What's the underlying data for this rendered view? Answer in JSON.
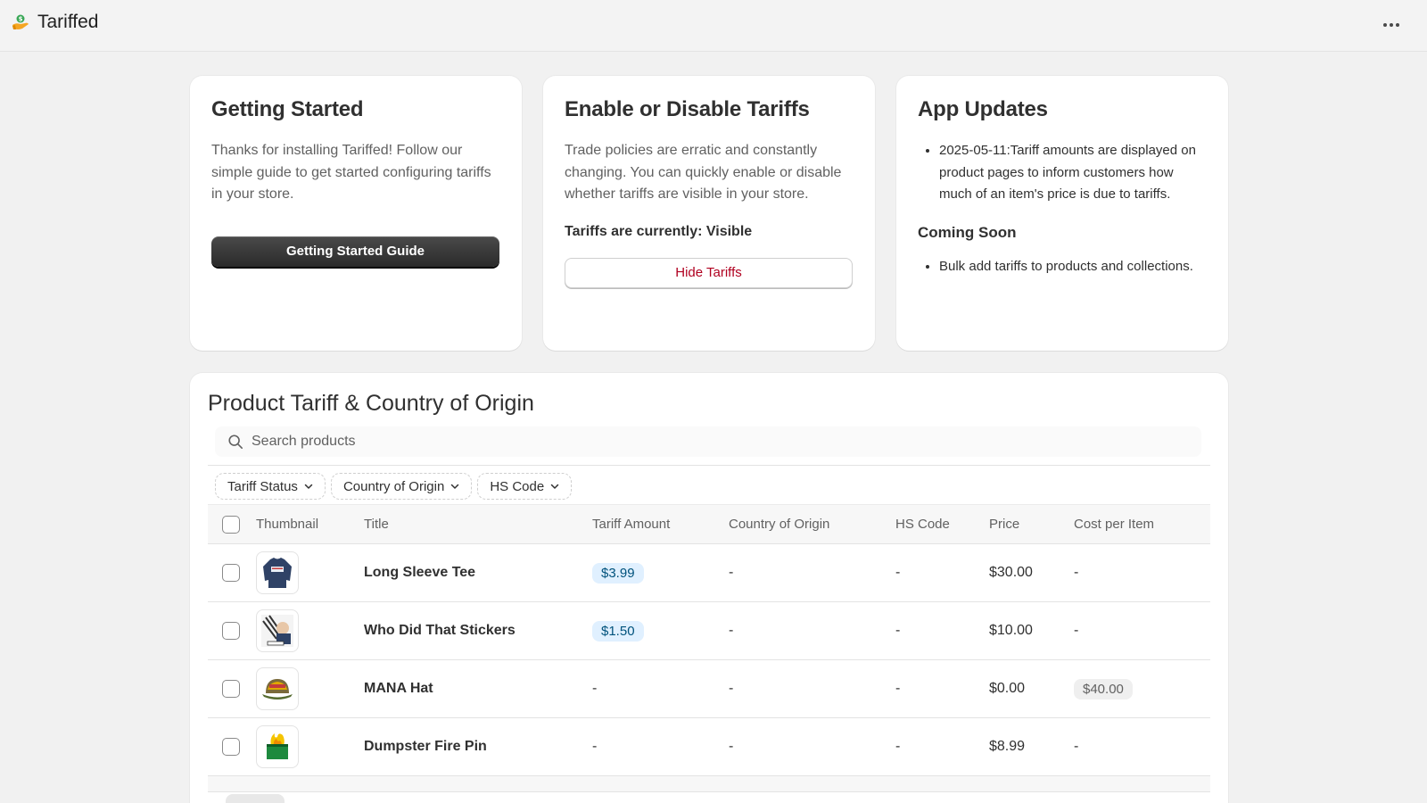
{
  "app": {
    "name": "Tariffed"
  },
  "getting_started": {
    "title": "Getting Started",
    "body": "Thanks for installing Tariffed! Follow our simple guide to get started configuring tariffs in your store.",
    "button_label": "Getting Started Guide"
  },
  "enable_disable": {
    "title": "Enable or Disable Tariffs",
    "body": "Trade policies are erratic and constantly changing. You can quickly enable or disable whether tariffs are visible in your store.",
    "status_label": "Tariffs are currently: Visible",
    "button_label": "Hide Tariffs"
  },
  "app_updates": {
    "title": "App Updates",
    "updates": [
      "2025-05-11:Tariff amounts are displayed on product pages to inform customers how much of an item's price is due to tariffs."
    ],
    "coming_soon_title": "Coming Soon",
    "coming_soon": [
      "Bulk add tariffs to products and collections."
    ]
  },
  "products": {
    "title": "Product Tariff & Country of Origin",
    "search_placeholder": "Search products",
    "filters": [
      "Tariff Status",
      "Country of Origin",
      "HS Code"
    ],
    "columns": {
      "thumbnail": "Thumbnail",
      "title": "Title",
      "tariff": "Tariff Amount",
      "country": "Country of Origin",
      "hs": "HS Code",
      "price": "Price",
      "cost": "Cost per Item"
    },
    "rows": [
      {
        "title": "Long Sleeve Tee",
        "tariff": "$3.99",
        "country": "-",
        "hs": "-",
        "price": "$30.00",
        "cost": "-"
      },
      {
        "title": "Who Did That Stickers",
        "tariff": "$1.50",
        "country": "-",
        "hs": "-",
        "price": "$10.00",
        "cost": "-"
      },
      {
        "title": "MANA Hat",
        "tariff": "-",
        "country": "-",
        "hs": "-",
        "price": "$0.00",
        "cost": "$40.00"
      },
      {
        "title": "Dumpster Fire Pin",
        "tariff": "-",
        "country": "-",
        "hs": "-",
        "price": "$8.99",
        "cost": "-"
      }
    ]
  },
  "icons": {
    "brand": "tariffed-logo-icon",
    "more": "more-horizontal-icon",
    "search": "search-icon",
    "chevron": "chevron-down-icon"
  },
  "colors": {
    "page_bg": "#f1f1f1",
    "primary_button": "#303030",
    "critical_text": "#b00020",
    "tariff_badge_bg": "#e0f0ff",
    "tariff_badge_text": "#00527c"
  }
}
